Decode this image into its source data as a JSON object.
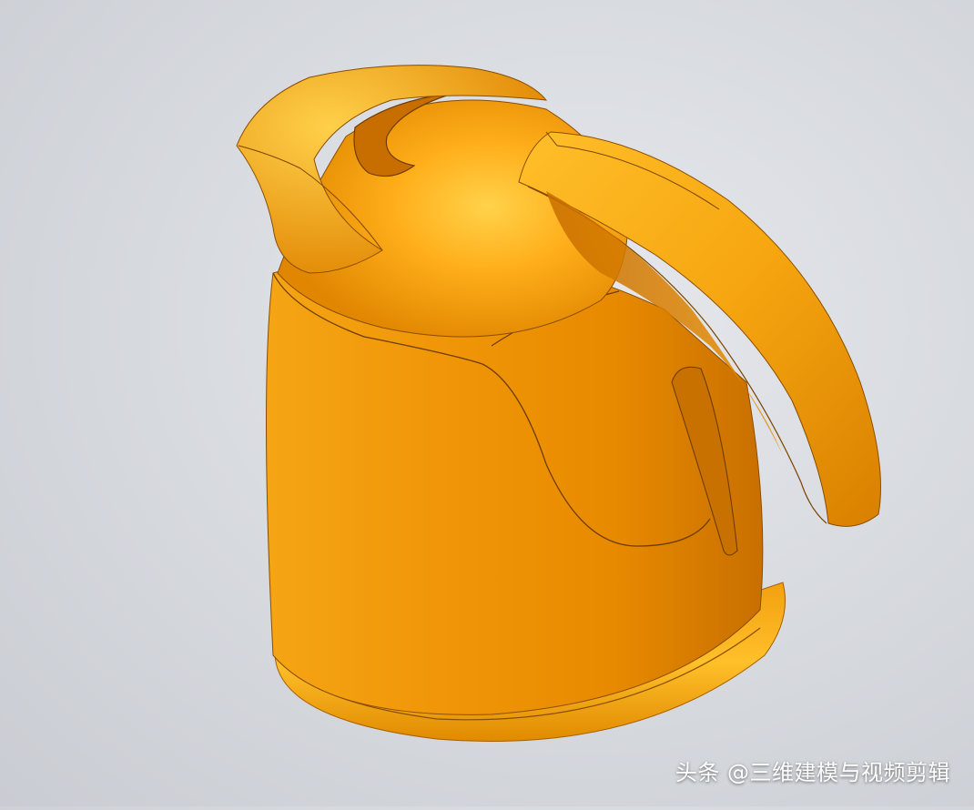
{
  "scene": {
    "subject": "kettle-3d-model",
    "colors": {
      "background": "#d8dbe0",
      "body_light": "#ffb21e",
      "body_mid": "#f29a0a",
      "body_dark": "#c86d00",
      "edge_line": "#7a4400"
    }
  },
  "watermark": {
    "text": "头条 @三维建模与视频剪辑"
  }
}
